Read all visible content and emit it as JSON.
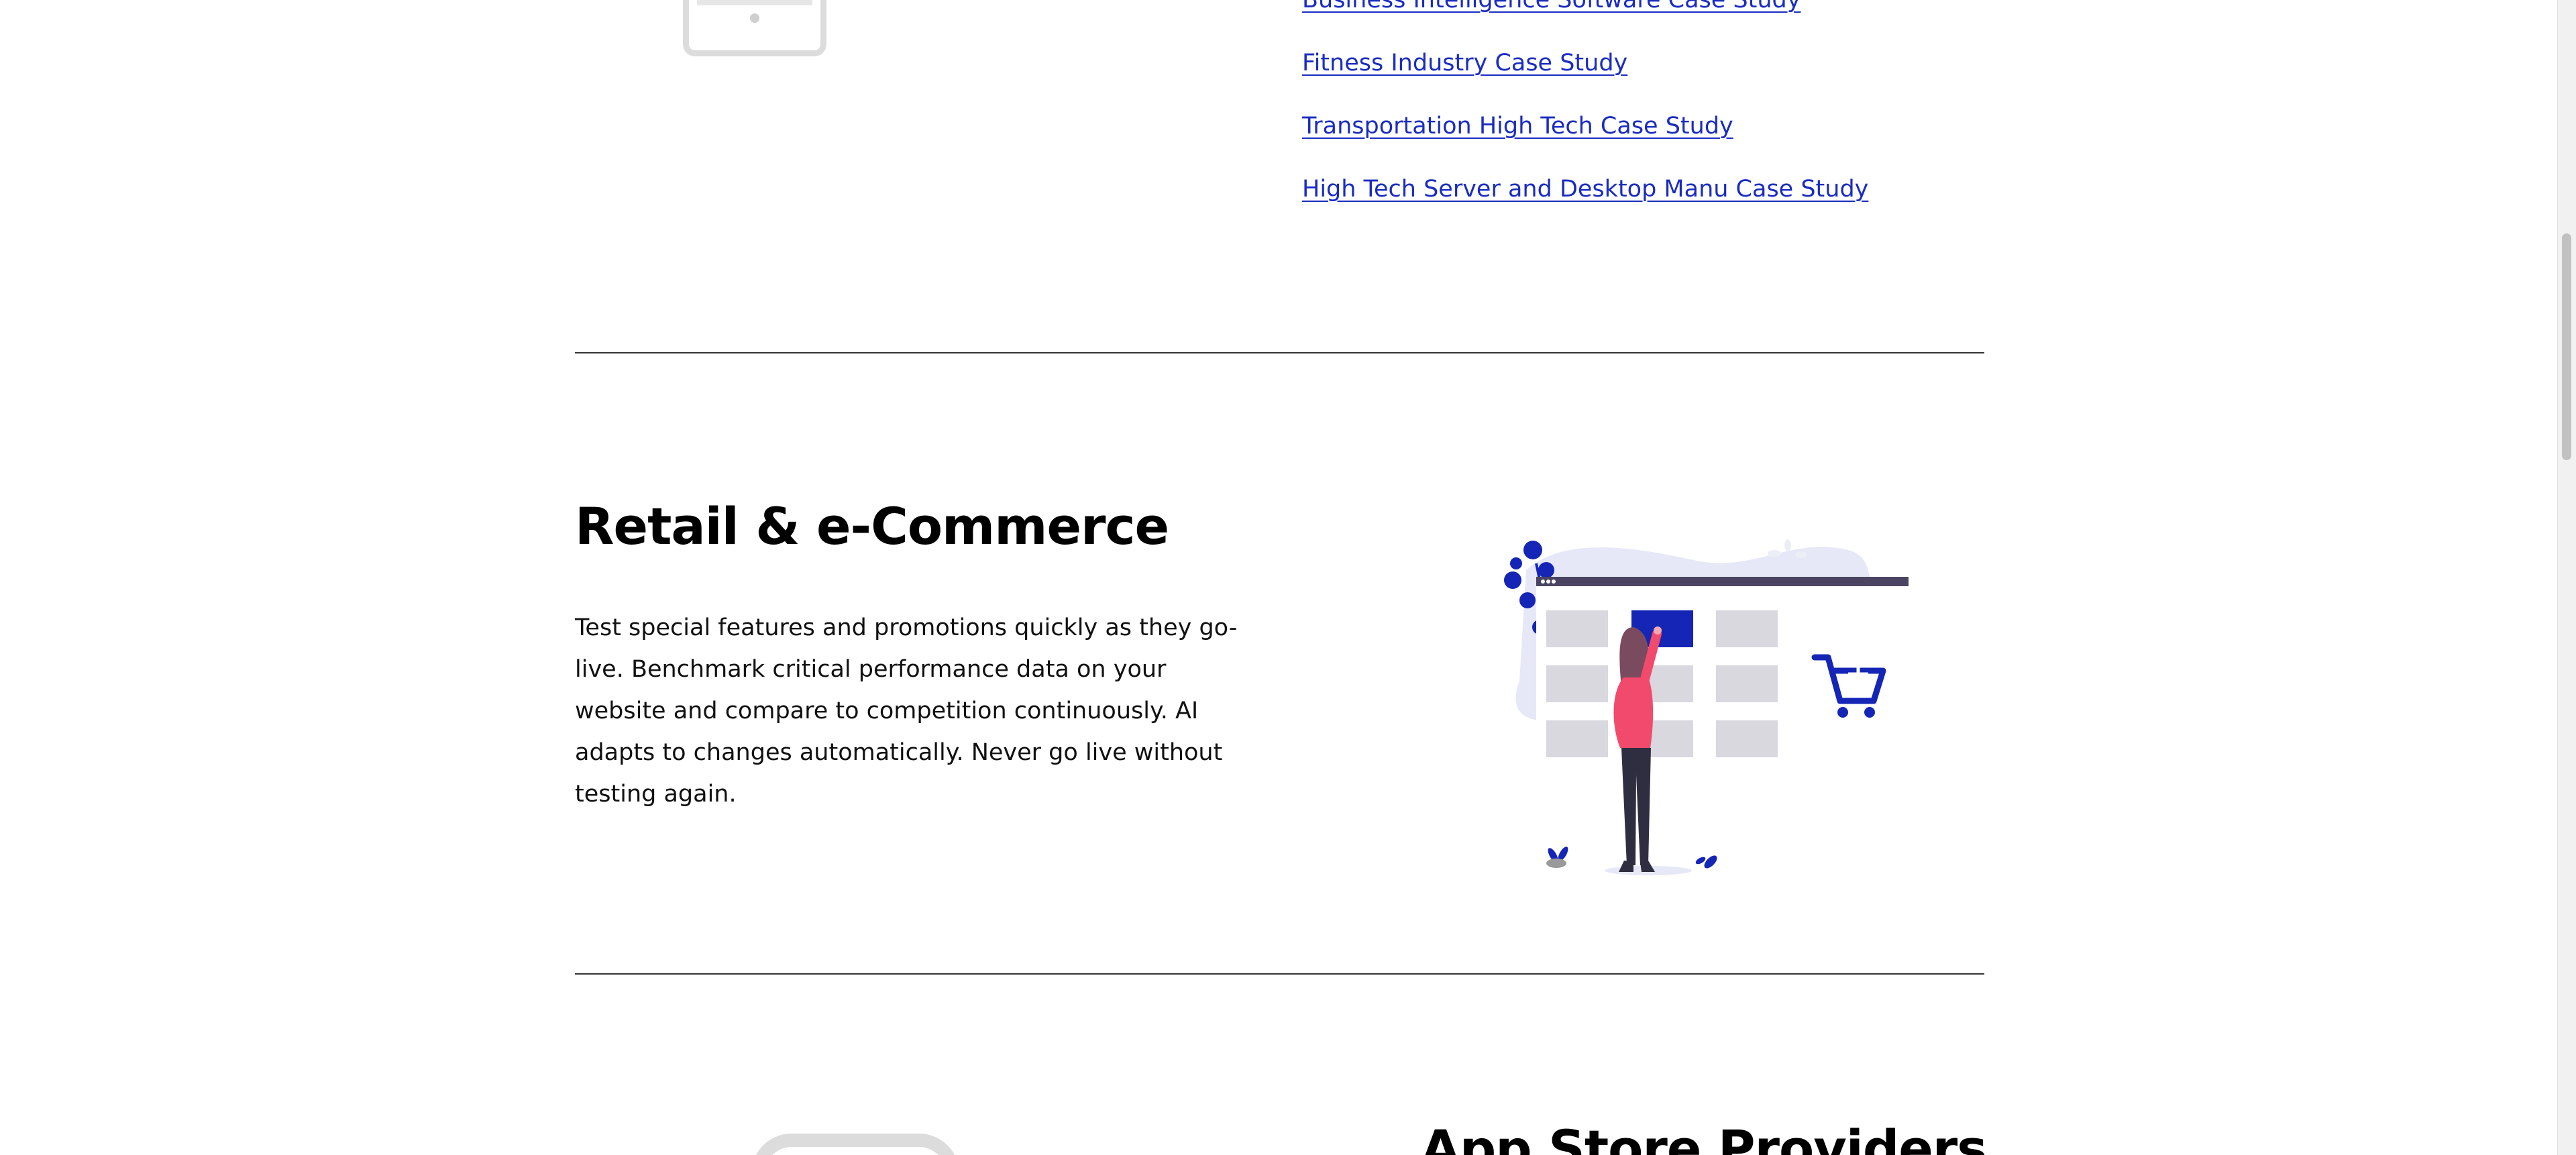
{
  "case_studies": {
    "links": [
      "Business Intelligence Software Case Study",
      "Fitness Industry Case Study",
      "Transportation High Tech Case Study",
      "High Tech Server and Desktop Manu Case Study"
    ]
  },
  "retail": {
    "title": "Retail & e-Commerce",
    "description": "Test special features and promotions quickly as they go-live. Benchmark critical performance data on your website and compare to competition continuously. AI adapts to changes automatically. Never go live without testing again."
  },
  "next_section": {
    "title": "App Store Providers"
  },
  "colors": {
    "accent": "#1a2cc0",
    "link": "#1a2cc0",
    "illustration_blue": "#1525b5",
    "illustration_pink": "#f14a6c",
    "divider": "#333333"
  },
  "icons": [
    "tablet-illustration",
    "shopping-cart-icon",
    "woman-shopping-illustration"
  ]
}
